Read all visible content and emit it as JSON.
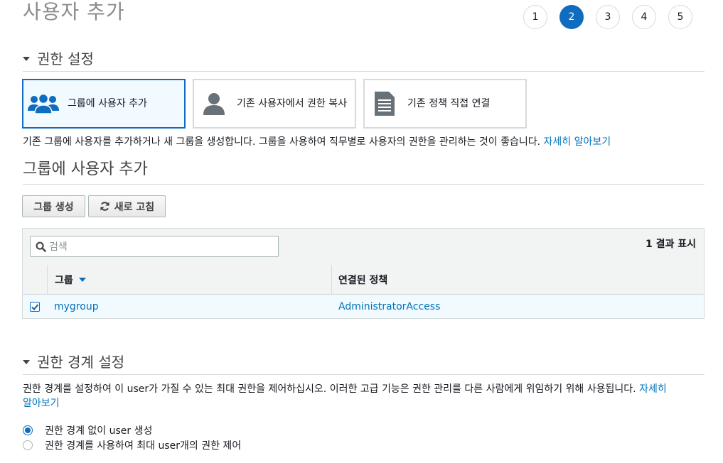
{
  "page": {
    "title": "사용자 추가"
  },
  "steps": [
    {
      "label": "1",
      "active": false
    },
    {
      "label": "2",
      "active": true
    },
    {
      "label": "3",
      "active": false
    },
    {
      "label": "4",
      "active": false
    },
    {
      "label": "5",
      "active": false
    }
  ],
  "permissions": {
    "heading": "권한 설정",
    "options": [
      {
        "label": "그룹에 사용자 추가",
        "icon": "users-group-icon",
        "selected": true
      },
      {
        "label": "기존 사용자에서 권한 복사",
        "icon": "user-icon",
        "selected": false
      },
      {
        "label": "기존 정책 직접 연결",
        "icon": "document-icon",
        "selected": false
      }
    ],
    "description": "기존 그룹에 사용자를 추가하거나 새 그룹을 생성합니다. 그룹을 사용하여 직무별로 사용자의 권한을 관리하는 것이 좋습니다.",
    "learn_more": "자세히 알아보기"
  },
  "group_section": {
    "heading": "그룹에 사용자 추가",
    "create_button": "그룹 생성",
    "refresh_button": "새로 고침"
  },
  "table": {
    "search_placeholder": "검색",
    "result_count": "1 결과 표시",
    "columns": [
      "그룹",
      "연결된 정책"
    ],
    "rows": [
      {
        "group": "mygroup",
        "policy": "AdministratorAccess",
        "checked": true
      }
    ]
  },
  "boundary": {
    "heading": "권한 경계 설정",
    "description": "권한 경계를 설정하여 이 user가 가질 수 있는 최대 권한을 제어하십시오. 이러한 고급 기능은 권한 관리를 다른 사람에게 위임하기 위해 사용됩니다.",
    "learn_more_1": "자세히",
    "learn_more_2": "알아보기",
    "options": [
      {
        "label": "권한 경계 없이 user 생성",
        "selected": true
      },
      {
        "label": "권한 경계를 사용하여 최대 user개의 권한 제어",
        "selected": false
      }
    ]
  },
  "colors": {
    "accent": "#0f6cbf",
    "link": "#0073bb",
    "selected_bg": "#f1faff"
  }
}
